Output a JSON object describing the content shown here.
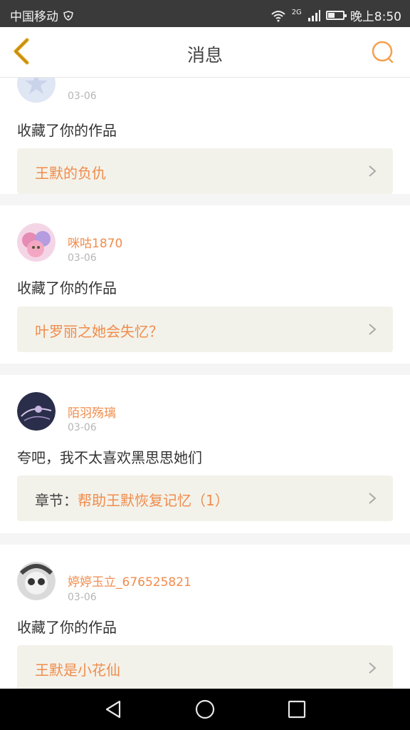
{
  "status_bar": {
    "carrier": "中国移动",
    "network": "2G",
    "time": "晚上8:50"
  },
  "header": {
    "title": "消息",
    "back_icon": "chevron-left-icon",
    "search_icon": "search-icon",
    "accent": "#f0a030"
  },
  "feed": {
    "items": [
      {
        "user": "",
        "date": "03-06",
        "message": "收藏了你的作品",
        "work_prefix": "",
        "work_title": "王默的负仇"
      },
      {
        "user": "咪咕1870",
        "date": "03-06",
        "message": "收藏了你的作品",
        "work_prefix": "",
        "work_title": "叶罗丽之她会失忆？"
      },
      {
        "user": "陌羽殇璃",
        "date": "03-06",
        "message": "夸吧，我不太喜欢黑思思她们",
        "work_prefix": "章节：",
        "work_title": "帮助王默恢复记忆（1）"
      },
      {
        "user": "婷婷玉立_676525821",
        "date": "03-06",
        "message": "收藏了你的作品",
        "work_prefix": "",
        "work_title": "王默是小花仙"
      }
    ]
  },
  "colors": {
    "username": "#f08c4c",
    "work_bg": "#f3f2ea",
    "divider": "#f5f5f5"
  },
  "system_nav": {
    "back": "triangle-back-icon",
    "home": "circle-home-icon",
    "recent": "square-recent-icon"
  }
}
